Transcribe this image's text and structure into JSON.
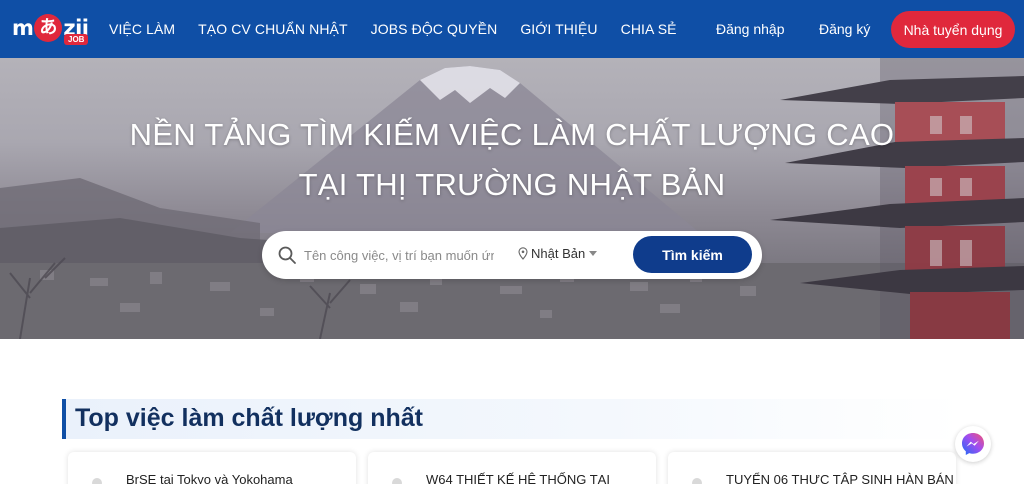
{
  "brand": {
    "logo_m": "m",
    "logo_a": "あ",
    "logo_zii": "zii",
    "logo_job": "JOB",
    "color_primary": "#0f4fa6",
    "color_accent": "#e0283c"
  },
  "nav": {
    "items": [
      "VIỆC LÀM",
      "TẠO CV CHUẨN NHẬT",
      "JOBS ĐỘC QUYỀN",
      "GIỚI THIỆU",
      "CHIA SẺ"
    ]
  },
  "auth": {
    "login": "Đăng nhập",
    "register": "Đăng ký",
    "employer": "Nhà tuyển dụng"
  },
  "hero": {
    "title_line1": "NỀN TẢNG TÌM KIẾM VIỆC LÀM CHẤT LƯỢNG CAO",
    "title_line2": "TẠI THỊ TRƯỜNG NHẬT BẢN"
  },
  "search": {
    "placeholder": "Tên công việc, vị trí bạn muốn ứng tuyển",
    "location": "Nhật Bản",
    "button": "Tìm kiếm",
    "icons": {
      "search": "search-icon",
      "location": "map-pin-icon",
      "dropdown": "caret-down-icon"
    }
  },
  "section": {
    "title": "Top việc làm chất lượng nhất"
  },
  "jobs": [
    {
      "title": "BrSE tại Tokyo và Yokohama"
    },
    {
      "title": "W64 THIẾT KẾ HỆ THỐNG TẠI"
    },
    {
      "title": "TUYỂN 06 THỰC TẬP SINH HÀN BÁN"
    }
  ],
  "floating": {
    "messenger_icon": "messenger-icon"
  }
}
